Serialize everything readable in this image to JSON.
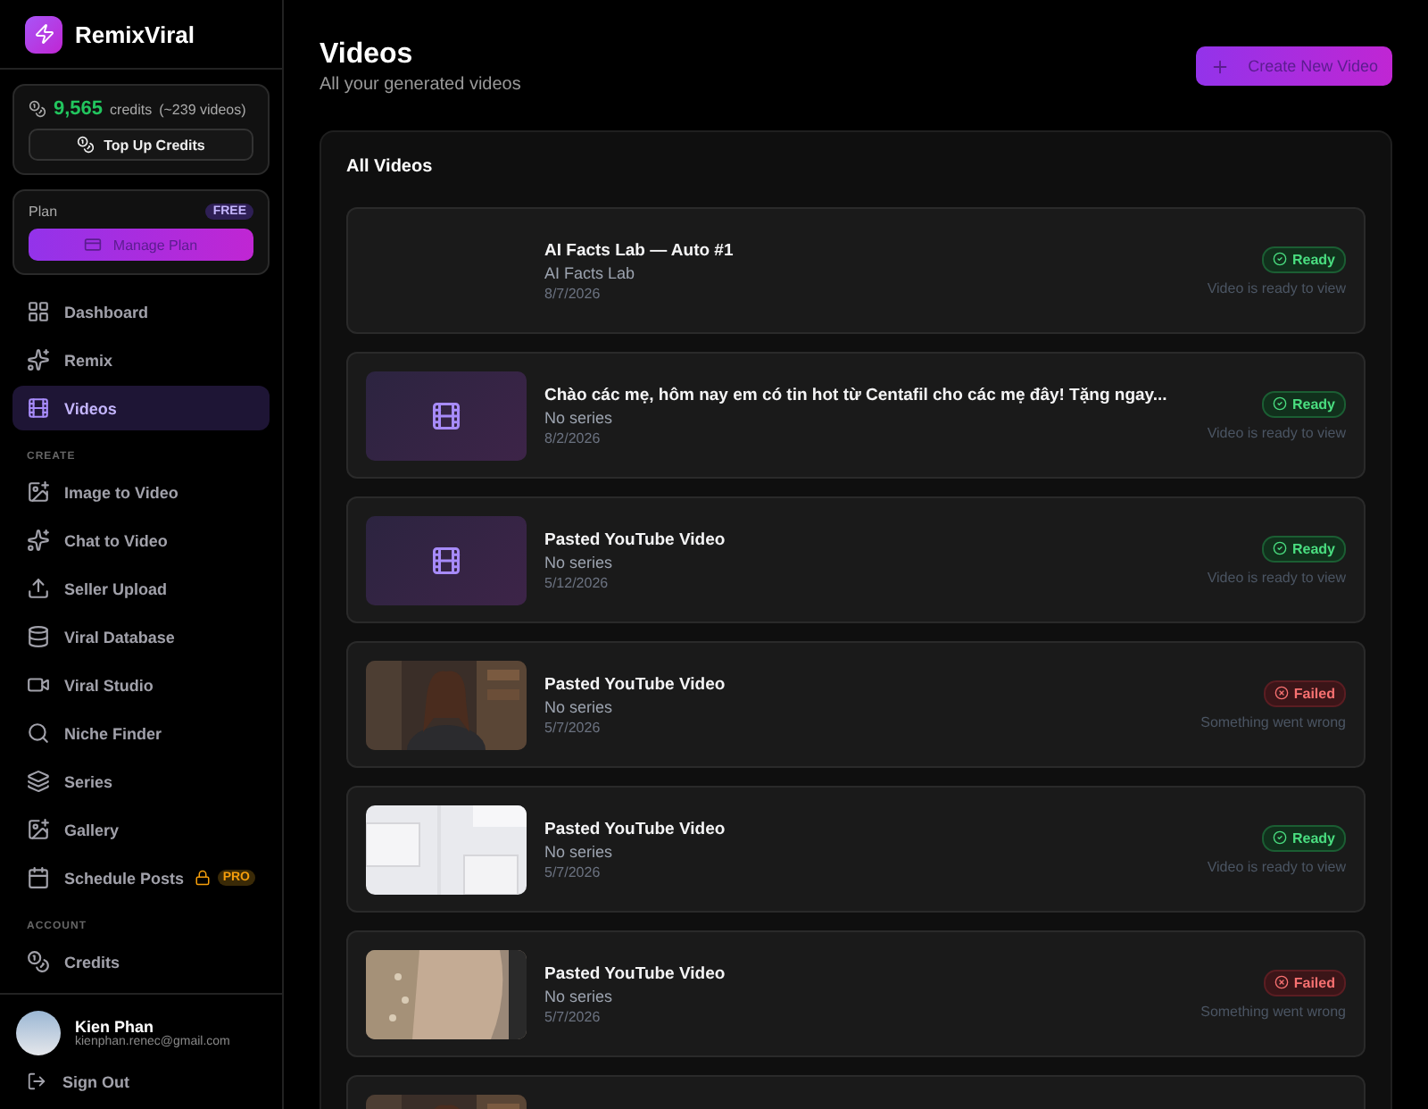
{
  "brand": {
    "name": "RemixViral"
  },
  "credits": {
    "amount": "9,565",
    "label": "credits",
    "note": "(~239 videos)",
    "button": "Top Up Credits"
  },
  "plan": {
    "label": "Plan",
    "badge": "FREE",
    "button": "Manage Plan"
  },
  "nav": [
    {
      "label": "Dashboard",
      "selected": false
    },
    {
      "label": "Remix",
      "selected": false
    },
    {
      "label": "Videos",
      "selected": true
    }
  ],
  "sections": [
    {
      "title": "CREATE",
      "items": [
        {
          "label": "Image to Video",
          "selected": false
        },
        {
          "label": "Chat to Video",
          "selected": false
        },
        {
          "label": "Seller Upload",
          "selected": false
        },
        {
          "label": "Viral Database",
          "selected": false
        },
        {
          "label": "Viral Studio",
          "selected": false
        },
        {
          "label": "Niche Finder",
          "selected": false
        },
        {
          "label": "Series",
          "selected": false
        },
        {
          "label": "Gallery",
          "selected": false
        },
        {
          "label": "Schedule Posts",
          "selected": false,
          "locked": true,
          "badge": "PRO"
        }
      ]
    },
    {
      "title": "ACCOUNT",
      "items": [
        {
          "label": "Credits",
          "selected": false
        }
      ]
    }
  ],
  "user": {
    "name": "Kien Phan",
    "email": "kienphan.renec@gmail.com"
  },
  "sign_out": "Sign Out",
  "header": {
    "title": "Videos",
    "subtitle": "All your generated videos",
    "button": "Create New Video"
  },
  "panel": {
    "title": "All Videos",
    "videos": [
      {
        "title": "AI Facts Lab — Auto #1",
        "series": "AI Facts Lab",
        "date": "8/7/2026",
        "kind": "blank",
        "failed": false,
        "status_label": "Ready",
        "status_note": "Video is ready to view"
      },
      {
        "title": "Chào các mẹ, hôm nay em có tin hot từ Centafil cho các mẹ đây! Tặng ngay...",
        "series": "No series",
        "date": "8/2/2026",
        "kind": "placeholder",
        "failed": false,
        "status_label": "Ready",
        "status_note": "Video is ready to view"
      },
      {
        "title": "Pasted YouTube Video",
        "series": "No series",
        "date": "5/12/2026",
        "kind": "placeholder",
        "failed": false,
        "status_label": "Ready",
        "status_note": "Video is ready to view"
      },
      {
        "title": "Pasted YouTube Video",
        "series": "No series",
        "date": "5/7/2026",
        "kind": "picture",
        "failed": true,
        "status_label": "Failed",
        "status_note": "Something went wrong"
      },
      {
        "title": "Pasted YouTube Video",
        "series": "No series",
        "date": "5/7/2026",
        "kind": "picture",
        "failed": false,
        "status_label": "Ready",
        "status_note": "Video is ready to view"
      },
      {
        "title": "Pasted YouTube Video",
        "series": "No series",
        "date": "5/7/2026",
        "kind": "picture",
        "failed": true,
        "status_label": "Failed",
        "status_note": "Something went wrong"
      },
      {
        "kind": "picture"
      }
    ]
  }
}
